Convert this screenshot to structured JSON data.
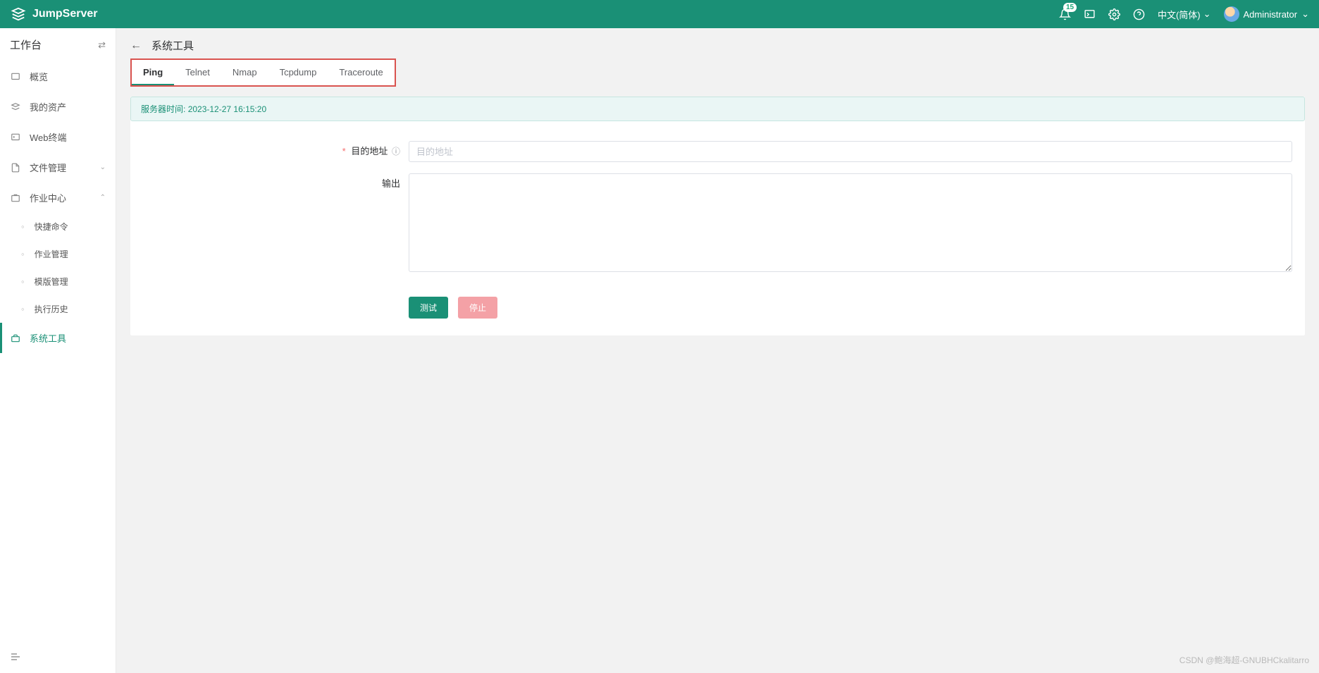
{
  "header": {
    "brand": "JumpServer",
    "badge_count": "15",
    "language": "中文(简体)",
    "username": "Administrator"
  },
  "sidebar": {
    "title": "工作台",
    "items": {
      "overview": "概览",
      "my_assets": "我的资产",
      "web_terminal": "Web终端",
      "file_mgmt": "文件管理",
      "job_center": "作业中心",
      "system_tools": "系统工具"
    },
    "job_sub": {
      "quick_cmd": "快捷命令",
      "job_mgmt": "作业管理",
      "template_mgmt": "模版管理",
      "exec_history": "执行历史"
    }
  },
  "page": {
    "title": "系统工具",
    "tabs": {
      "ping": "Ping",
      "telnet": "Telnet",
      "nmap": "Nmap",
      "tcpdump": "Tcpdump",
      "traceroute": "Traceroute"
    },
    "server_time_label": "服务器时间:",
    "server_time_value": "2023-12-27 16:15:20",
    "form": {
      "target_label": "目的地址",
      "target_placeholder": "目的地址",
      "output_label": "输出"
    },
    "buttons": {
      "test": "测试",
      "stop": "停止"
    }
  },
  "watermark": "CSDN @鲍海超-GNUBHCkalitarro"
}
